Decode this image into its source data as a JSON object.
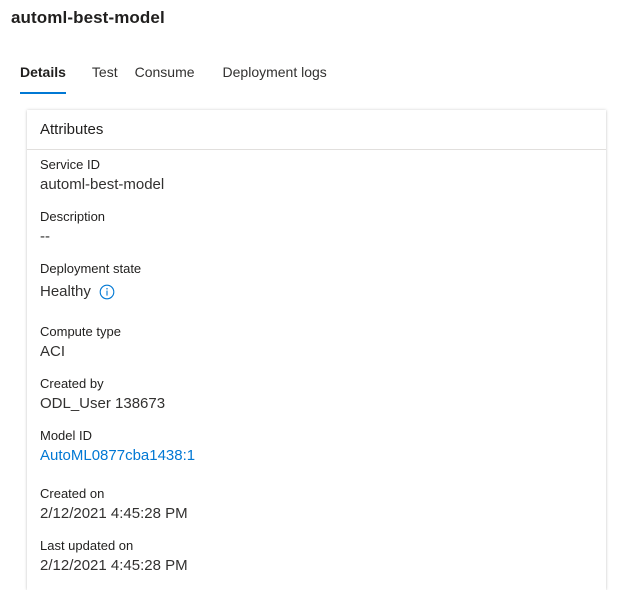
{
  "page": {
    "title": "automl-best-model"
  },
  "tabs": [
    {
      "label": "Details",
      "active": true
    },
    {
      "label": "Test",
      "active": false
    },
    {
      "label": "Consume",
      "active": false
    },
    {
      "label": "Deployment logs",
      "active": false
    }
  ],
  "attributes": {
    "header": "Attributes",
    "service_id": {
      "label": "Service ID",
      "value": "automl-best-model"
    },
    "description": {
      "label": "Description",
      "value": "--"
    },
    "deployment_state": {
      "label": "Deployment state",
      "value": "Healthy",
      "icon": "info-icon"
    },
    "compute_type": {
      "label": "Compute type",
      "value": "ACI"
    },
    "created_by": {
      "label": "Created by",
      "value": "ODL_User 138673"
    },
    "model_id": {
      "label": "Model ID",
      "value": "AutoML0877cba1438:1"
    },
    "created_on": {
      "label": "Created on",
      "value": "2/12/2021 4:45:28 PM"
    },
    "last_updated_on": {
      "label": "Last updated on",
      "value": "2/12/2021 4:45:28 PM"
    }
  },
  "colors": {
    "accent": "#0078d4",
    "text": "#323130",
    "divider": "#e1dfdd"
  }
}
